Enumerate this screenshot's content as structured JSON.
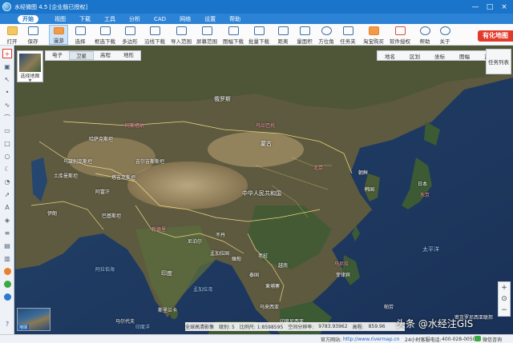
{
  "window": {
    "title": "水经微图 4.5 [企业版已授权]",
    "controls": [
      "—",
      "□",
      "×"
    ]
  },
  "menu": [
    "开始",
    "视图",
    "下载",
    "工具",
    "分析",
    "CAD",
    "网络",
    "设置",
    "帮助"
  ],
  "ribbon": {
    "buttons": [
      {
        "label": "打开",
        "icon": "folder-open-icon"
      },
      {
        "label": "保存",
        "icon": "save-icon"
      },
      {
        "label": "漫游",
        "icon": "hand-pan-icon"
      },
      {
        "label": "选择",
        "icon": "cursor-select-icon"
      },
      {
        "label": "框选下载",
        "icon": "box-download-icon"
      },
      {
        "label": "多边形",
        "icon": "polygon-icon"
      },
      {
        "label": "沿线下载",
        "icon": "line-download-icon"
      },
      {
        "label": "导入范围",
        "icon": "import-range-icon"
      },
      {
        "label": "屏幕范围",
        "icon": "screen-range-icon"
      },
      {
        "label": "图幅下载",
        "icon": "sheet-download-icon"
      },
      {
        "label": "批量下载",
        "icon": "batch-download-icon"
      },
      {
        "label": "距离",
        "icon": "distance-icon"
      },
      {
        "label": "量面积",
        "icon": "area-icon"
      },
      {
        "label": "方位角",
        "icon": "azimuth-icon"
      },
      {
        "label": "任务夹",
        "icon": "task-folder-icon"
      },
      {
        "label": "淘宝购买",
        "icon": "taobao-icon"
      },
      {
        "label": "软件授权",
        "icon": "license-icon"
      },
      {
        "label": "帮助",
        "icon": "help-icon"
      },
      {
        "label": "关于",
        "icon": "about-icon"
      }
    ],
    "promo": "有化地图"
  },
  "map": {
    "selector_label": "选择地图",
    "type_tabs": [
      "电子",
      "卫星",
      "高程",
      "地形"
    ],
    "active_type": "卫星",
    "overlay_tabs": [
      "地名",
      "区划",
      "坐标",
      "图幅",
      "瓦片"
    ],
    "task_list": "任务列表",
    "minimap_label": "地球",
    "zoom": [
      "+",
      "⊙",
      "−"
    ],
    "labels": [
      {
        "text": "俄罗斯",
        "cls": "white big"
      },
      {
        "text": "哈萨克斯坦",
        "cls": "white"
      },
      {
        "text": "蒙古",
        "cls": "white big"
      },
      {
        "text": "中华人民共和国",
        "cls": "white big"
      },
      {
        "text": "北京",
        "cls": "pink"
      },
      {
        "text": "乌兰巴托",
        "cls": "pink"
      },
      {
        "text": "阿斯塔纳",
        "cls": "pink"
      },
      {
        "text": "朝鲜",
        "cls": "white"
      },
      {
        "text": "韩国",
        "cls": "white"
      },
      {
        "text": "日本",
        "cls": "white"
      },
      {
        "text": "东京",
        "cls": "pink"
      },
      {
        "text": "印度",
        "cls": "white big"
      },
      {
        "text": "新德里",
        "cls": "pink"
      },
      {
        "text": "巴基斯坦",
        "cls": "white"
      },
      {
        "text": "阿富汗",
        "cls": "white"
      },
      {
        "text": "伊朗",
        "cls": "white"
      },
      {
        "text": "土库曼斯坦",
        "cls": "white"
      },
      {
        "text": "乌兹别克斯坦",
        "cls": "white"
      },
      {
        "text": "吉尔吉斯斯坦",
        "cls": "white"
      },
      {
        "text": "塔吉克斯坦",
        "cls": "white"
      },
      {
        "text": "尼泊尔",
        "cls": "white"
      },
      {
        "text": "不丹",
        "cls": "white"
      },
      {
        "text": "孟加拉国",
        "cls": "white"
      },
      {
        "text": "缅甸",
        "cls": "white"
      },
      {
        "text": "泰国",
        "cls": "white"
      },
      {
        "text": "老挝",
        "cls": "white"
      },
      {
        "text": "越南",
        "cls": "white"
      },
      {
        "text": "柬埔寨",
        "cls": "white"
      },
      {
        "text": "菲律宾",
        "cls": "white"
      },
      {
        "text": "马尼拉",
        "cls": "pink"
      },
      {
        "text": "马来西亚",
        "cls": "white"
      },
      {
        "text": "斯里兰卡",
        "cls": "white"
      },
      {
        "text": "印度尼西亚",
        "cls": "white"
      },
      {
        "text": "太平洋",
        "cls": "sea"
      },
      {
        "text": "印度洋",
        "cls": "sea"
      },
      {
        "text": "孟加拉湾",
        "cls": "sea"
      },
      {
        "text": "阿拉伯海",
        "cls": "sea"
      },
      {
        "text": "密克罗尼西亚联邦",
        "cls": "white"
      },
      {
        "text": "帕劳",
        "cls": "white"
      },
      {
        "text": "马尔代夫",
        "cls": "white"
      }
    ]
  },
  "map_status": {
    "level_label": "全球高清影像",
    "level": "级别: 5",
    "scale": "比例尺: 1:8598595",
    "resolution_label": "空间分辨率:",
    "resolution": "9783.93962",
    "altitude_label": "高程:",
    "altitude": "859.96"
  },
  "statusbar": {
    "site_label": "官方网站:",
    "site": "http://www.rivermap.cn",
    "hotline_label": "24小时客服电话:",
    "hotline": "400-028-0050",
    "wechat": "微信咨询"
  },
  "watermark": "头条 @水经注GIS",
  "colors": {
    "title_bar": "#1a74c9",
    "menu_bar": "#2c83d6",
    "promo": "#e23a2a",
    "selected_tool": "#e0372a"
  }
}
